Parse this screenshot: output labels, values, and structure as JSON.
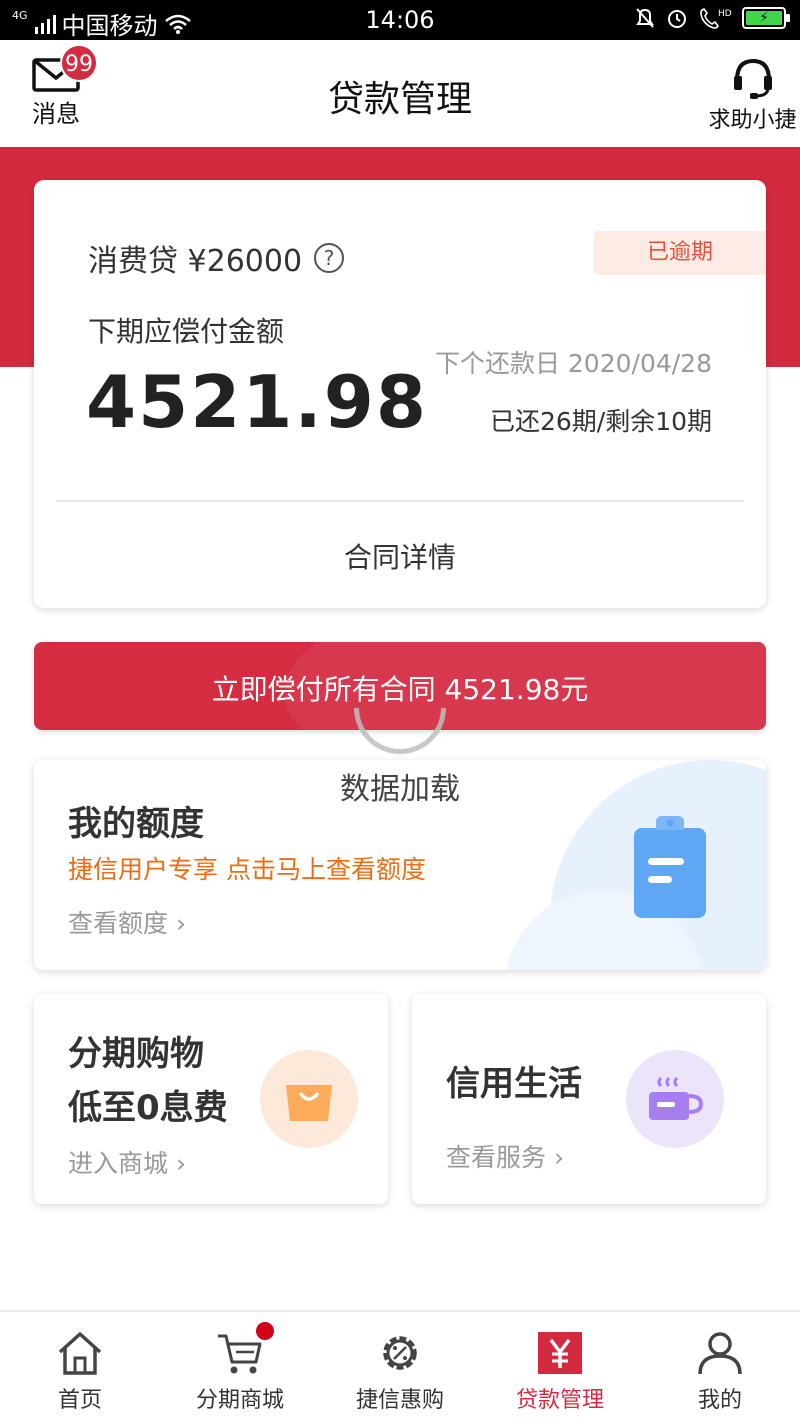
{
  "status_bar": {
    "network": "4G",
    "carrier": "中国移动",
    "time": "14:06",
    "hd": "HD"
  },
  "header": {
    "title": "贷款管理",
    "message_label": "消息",
    "message_badge": "99",
    "help_label": "求助小捷"
  },
  "loan_card": {
    "loan_type": "消费贷 ¥26000",
    "help_icon": "?",
    "status_tag": "已逾期",
    "next_payment_label": "下期应偿付金额",
    "next_payment_amount": "4521.98",
    "next_due_date": "下个还款日 2020/04/28",
    "periods": "已还26期/剩余10期",
    "contract_details": "合同详情"
  },
  "pay_button": {
    "label": "立即偿付所有合同 4521.98元"
  },
  "loading": {
    "text": "数据加载"
  },
  "quota_card": {
    "title": "我的额度",
    "subtitle": "捷信用户专享 点击马上查看额度",
    "link": "查看额度 ›",
    "icon": "clipboard-icon"
  },
  "installment_card": {
    "title_line1": "分期购物",
    "title_line2": "低至0息费",
    "link": "进入商城 ›",
    "icon": "shopping-bag-icon"
  },
  "credit_card": {
    "title": "信用生活",
    "link": "查看服务 ›",
    "icon": "coffee-cup-icon"
  },
  "tabs": [
    {
      "label": "首页",
      "icon": "home-icon"
    },
    {
      "label": "分期商城",
      "icon": "cart-icon"
    },
    {
      "label": "捷信惠购",
      "icon": "discount-gear-icon"
    },
    {
      "label": "贷款管理",
      "icon": "yen-icon"
    },
    {
      "label": "我的",
      "icon": "person-icon"
    }
  ],
  "colors": {
    "brand_red": "#d42a40",
    "orange_text": "#ee6d14",
    "overdue_text": "#e8503a",
    "clipboard_blue": "#5fa6f5"
  }
}
